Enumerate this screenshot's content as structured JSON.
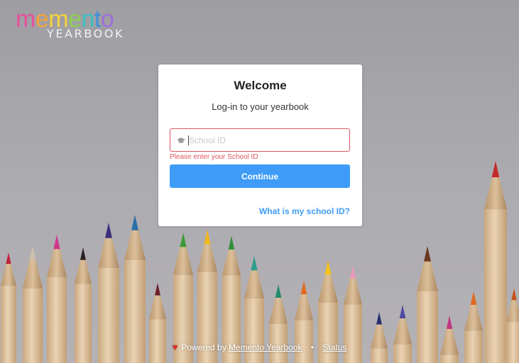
{
  "logo": {
    "word": "memento",
    "letter_colors": [
      "#e6509c",
      "#f2a43a",
      "#f4d43a",
      "#8fcf52",
      "#37c2c4",
      "#3d8fe0",
      "#9b6fdc"
    ],
    "subtitle": "YEARBOOK"
  },
  "card": {
    "title": "Welcome",
    "subtitle": "Log-in to your yearbook",
    "school_id": {
      "value": "",
      "placeholder": "School ID",
      "icon": "graduation-cap-icon",
      "error": "Please enter your School ID"
    },
    "continue_label": "Continue",
    "help_link": "What is my school ID?"
  },
  "footer": {
    "icon": "heart-icon",
    "powered_by": "Powered by",
    "brand_link": "Memento Yearbook",
    "separator": "•",
    "status_link": "Status"
  },
  "colors": {
    "accent": "#3e9cf7",
    "error": "#e0555f",
    "card_background": "#ffffff",
    "heart": "#d92828"
  }
}
